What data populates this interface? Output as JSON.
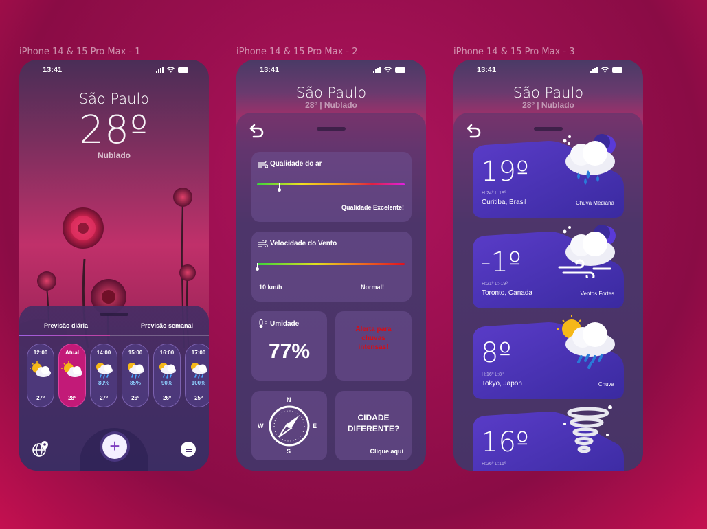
{
  "frames": [
    {
      "title": "iPhone 14 & 15 Pro Max - 1"
    },
    {
      "title": "iPhone 14 & 15 Pro Max - 2"
    },
    {
      "title": "iPhone 14 & 15 Pro Max - 3"
    }
  ],
  "status": {
    "time": "13:41"
  },
  "home": {
    "city": "São Paulo",
    "temp": "28º",
    "condition": "Nublado",
    "tabs": [
      "Previsão diária",
      "Previsão semanal"
    ],
    "hours": [
      {
        "hour": "12:00",
        "pct": "",
        "temp": "27º",
        "icon": "sun-cloud-icon",
        "active": false
      },
      {
        "hour": "Atual",
        "pct": "",
        "temp": "28º",
        "icon": "sun-cloud-icon",
        "active": true
      },
      {
        "hour": "14:00",
        "pct": "80%",
        "temp": "27º",
        "icon": "sun-rain-cloud-icon",
        "active": false
      },
      {
        "hour": "15:00",
        "pct": "85%",
        "temp": "26º",
        "icon": "sun-rain-cloud-icon",
        "active": false
      },
      {
        "hour": "16:00",
        "pct": "90%",
        "temp": "26º",
        "icon": "sun-rain-cloud-icon",
        "active": false
      },
      {
        "hour": "17:00",
        "pct": "100%",
        "temp": "25º",
        "icon": "sun-rain-cloud-icon",
        "active": false
      }
    ],
    "nav": {
      "plus": "+"
    }
  },
  "details": {
    "city": "São Paulo",
    "subtitle": "28º | Nublado",
    "air": {
      "label": "Qualidade do ar",
      "status": "Qualidade Excelente!",
      "level": 0.15
    },
    "wind": {
      "label": "Velocidade do Vento",
      "speed": "10 km/h",
      "status": "Normal!",
      "level": 0.0
    },
    "humidity": {
      "label": "Umidade",
      "value": "77%"
    },
    "alert": {
      "text": "Alerta para chuvas intensas!",
      "color": "#d4101a"
    },
    "compass": {
      "n": "N",
      "s": "S",
      "e": "E",
      "w": "W"
    },
    "other_city": {
      "title": "CIDADE DIFERENTE?",
      "link": "Clique aqui"
    }
  },
  "cities": {
    "city": "São Paulo",
    "subtitle": "28º | Nublado",
    "list": [
      {
        "temp": "19º",
        "hl": "H:24º  L:18º",
        "location": "Curitiba, Brasil",
        "condition": "Chuva Mediana",
        "icon": "moon-rain-cloud-icon"
      },
      {
        "temp": "-1º",
        "hl": "H:21º  L:-19º",
        "location": "Toronto, Canada",
        "condition": "Ventos Fortes",
        "icon": "moon-wind-cloud-icon"
      },
      {
        "temp": "8º",
        "hl": "H:16º  L:8º",
        "location": "Tokyo, Japon",
        "condition": "Chuva",
        "icon": "sun-rain-cloud-icon"
      },
      {
        "temp": "16º",
        "hl": "H:26º  L:16º",
        "location": "",
        "condition": "",
        "icon": "tornado-icon"
      }
    ]
  }
}
